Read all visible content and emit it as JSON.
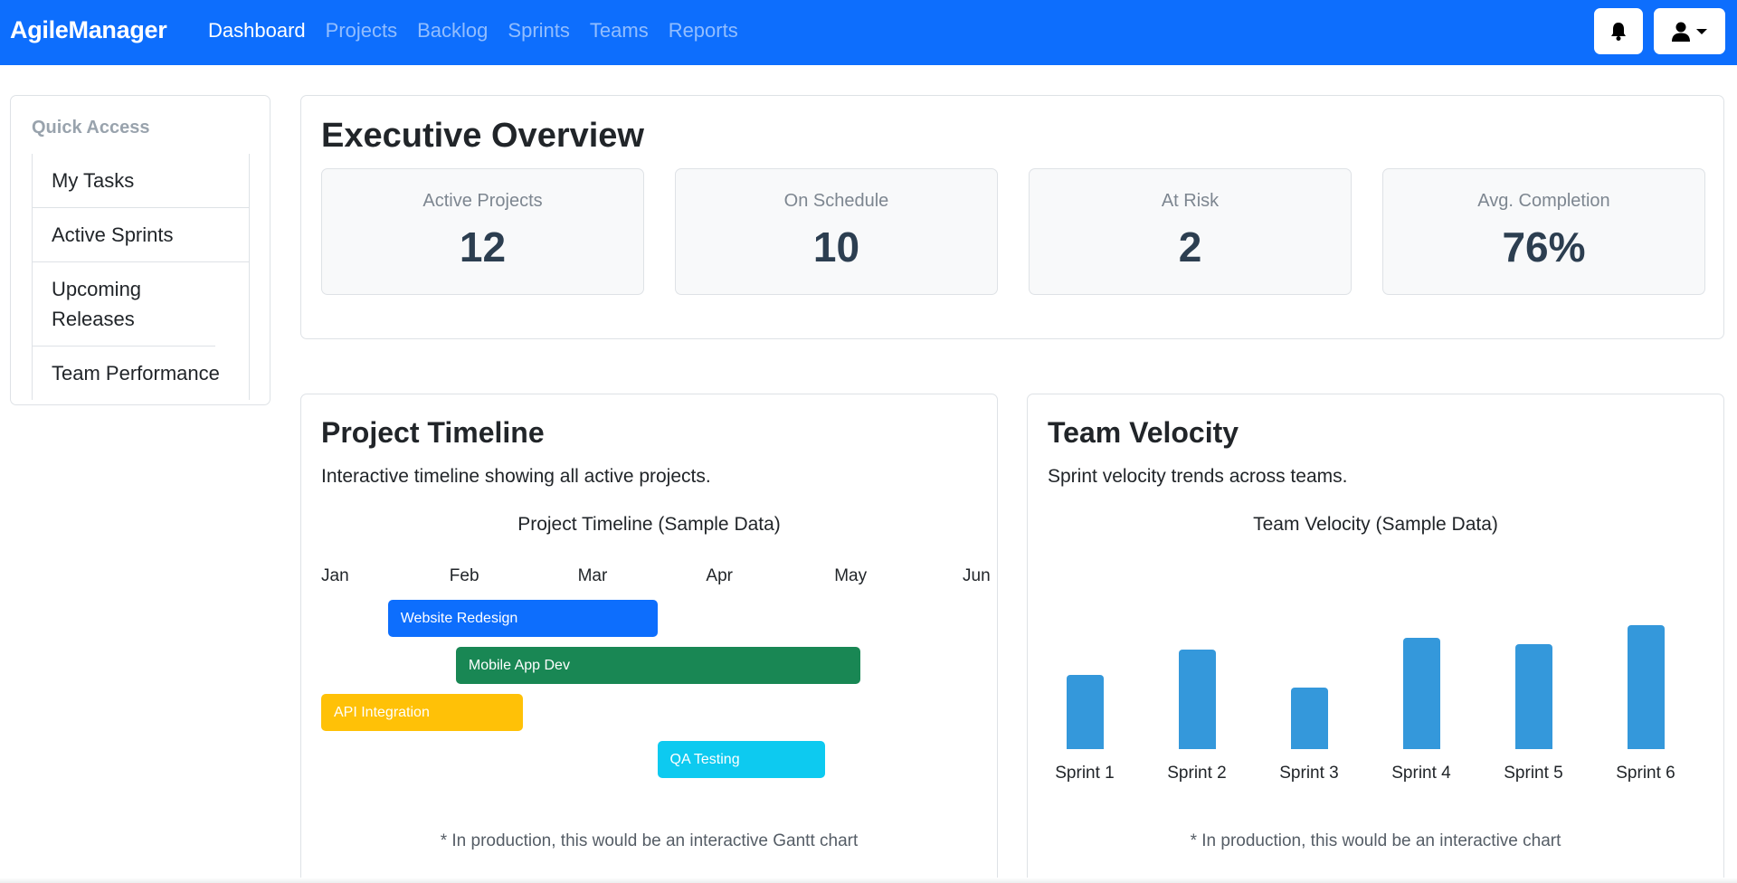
{
  "navbar": {
    "brand": "AgileManager",
    "links": [
      {
        "label": "Dashboard",
        "active": true
      },
      {
        "label": "Projects",
        "active": false
      },
      {
        "label": "Backlog",
        "active": false
      },
      {
        "label": "Sprints",
        "active": false
      },
      {
        "label": "Teams",
        "active": false
      },
      {
        "label": "Reports",
        "active": false
      }
    ],
    "bell_icon": "bell-icon",
    "user_icon": "user-icon",
    "accent_color": "#0d6efd"
  },
  "sidebar": {
    "heading": "Quick Access",
    "items": [
      {
        "label": "My Tasks"
      },
      {
        "label": "Active Sprints"
      },
      {
        "label": "Upcoming Releases"
      },
      {
        "label": "Team Performance"
      }
    ]
  },
  "overview": {
    "title": "Executive Overview",
    "stats": [
      {
        "label": "Active Projects",
        "value": "12"
      },
      {
        "label": "On Schedule",
        "value": "10"
      },
      {
        "label": "At Risk",
        "value": "2"
      },
      {
        "label": "Avg. Completion",
        "value": "76%"
      }
    ]
  },
  "timeline": {
    "title": "Project Timeline",
    "description": "Interactive timeline showing all active projects.",
    "note": "* In production, this would be an interactive Gantt chart"
  },
  "velocity": {
    "title": "Team Velocity",
    "description": "Sprint velocity trends across teams.",
    "note": "* In production, this would be an interactive chart"
  },
  "chart_data": [
    {
      "type": "bar",
      "subtype": "gantt",
      "title": "Project Timeline (Sample Data)",
      "months": [
        "Jan",
        "Feb",
        "Mar",
        "Apr",
        "May",
        "Jun"
      ],
      "tasks": [
        {
          "name": "Website Redesign",
          "start": 0.52,
          "end": 2.62,
          "color": "#0d6efd"
        },
        {
          "name": "Mobile App Dev",
          "start": 1.05,
          "end": 4.2,
          "color": "#198754"
        },
        {
          "name": "API Integration",
          "start": 0.0,
          "end": 1.57,
          "color": "#ffc107"
        },
        {
          "name": "QA Testing",
          "start": 2.62,
          "end": 3.93,
          "color": "#0dcaf0"
        }
      ]
    },
    {
      "type": "bar",
      "title": "Team Velocity (Sample Data)",
      "categories": [
        "Sprint 1",
        "Sprint 2",
        "Sprint 3",
        "Sprint 4",
        "Sprint 5",
        "Sprint 6"
      ],
      "values": [
        60,
        80,
        50,
        90,
        85,
        100
      ],
      "ylim": [
        0,
        100
      ],
      "color": "#3498db"
    }
  ]
}
